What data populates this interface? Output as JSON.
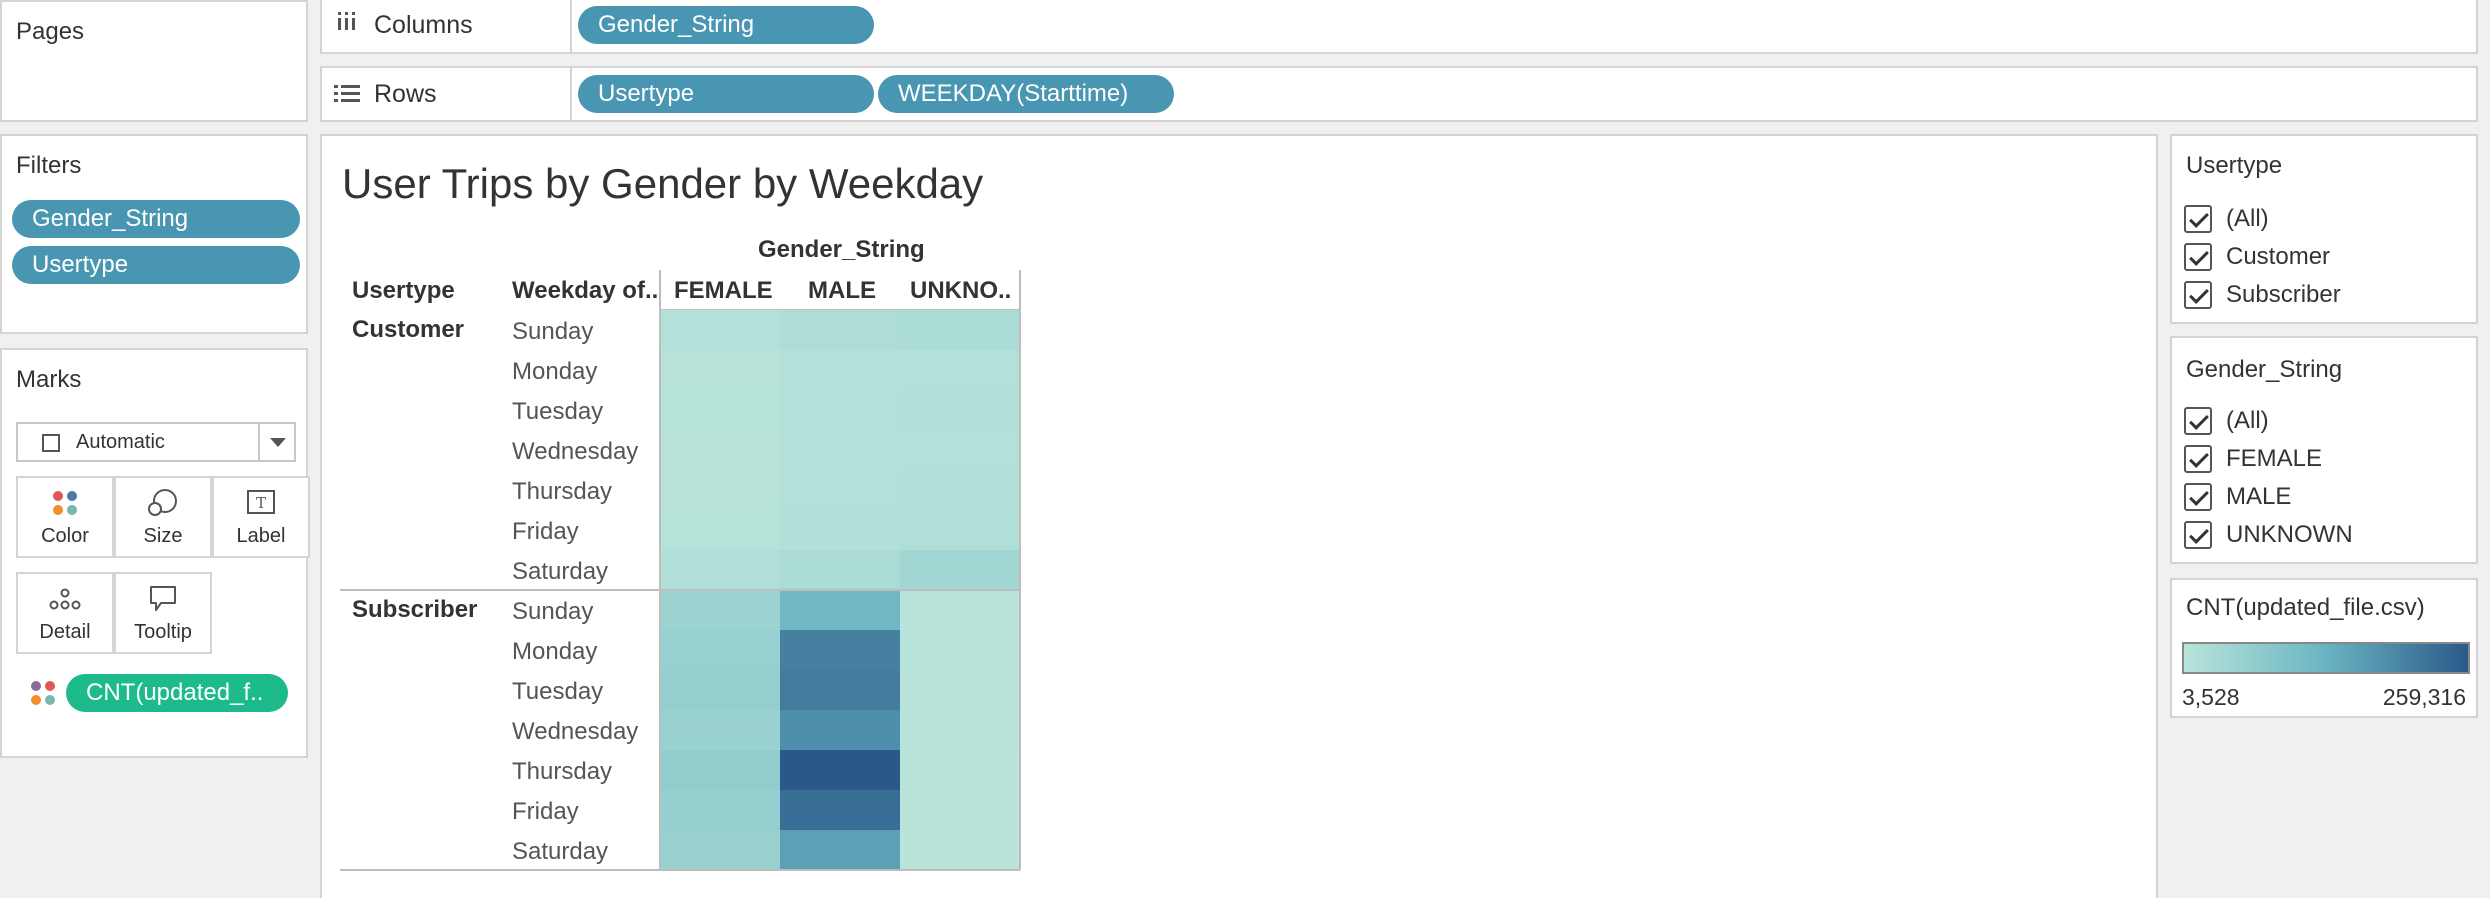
{
  "pages": {
    "title": "Pages"
  },
  "shelves": {
    "columns_label": "Columns",
    "rows_label": "Rows",
    "columns_pills": [
      "Gender_String"
    ],
    "rows_pills": [
      "Usertype",
      "WEEKDAY(Starttime)"
    ]
  },
  "filters": {
    "title": "Filters",
    "pills": [
      "Gender_String",
      "Usertype"
    ]
  },
  "marks": {
    "title": "Marks",
    "type": "Automatic",
    "buttons": [
      "Color",
      "Size",
      "Label",
      "Detail",
      "Tooltip"
    ],
    "field": "CNT(updated_f.."
  },
  "viz": {
    "title": "User Trips by Gender by Weekday",
    "col_field": "Gender_String",
    "row_header_1": "Usertype",
    "row_header_2": "Weekday of..",
    "columns": [
      "FEMALE",
      "MALE",
      "UNKNO.."
    ],
    "groups": [
      {
        "name": "Customer",
        "days": [
          "Sunday",
          "Monday",
          "Tuesday",
          "Wednesday",
          "Thursday",
          "Friday",
          "Saturday"
        ]
      },
      {
        "name": "Subscriber",
        "days": [
          "Sunday",
          "Monday",
          "Tuesday",
          "Wednesday",
          "Thursday",
          "Friday",
          "Saturday"
        ]
      }
    ]
  },
  "chart_data": {
    "type": "heatmap",
    "title": "User Trips by Gender by Weekday",
    "x_field": "Gender_String",
    "y_fields": [
      "Usertype",
      "Weekday of.."
    ],
    "x": [
      "FEMALE",
      "MALE",
      "UNKNO.."
    ],
    "y": [
      "Customer|Sunday",
      "Customer|Monday",
      "Customer|Tuesday",
      "Customer|Wednesday",
      "Customer|Thursday",
      "Customer|Friday",
      "Customer|Saturday",
      "Subscriber|Sunday",
      "Subscriber|Monday",
      "Subscriber|Tuesday",
      "Subscriber|Wednesday",
      "Subscriber|Thursday",
      "Subscriber|Friday",
      "Subscriber|Saturday"
    ],
    "values": [
      [
        14000,
        22000,
        26000
      ],
      [
        9000,
        13000,
        14000
      ],
      [
        9500,
        14000,
        15000
      ],
      [
        8000,
        13000,
        14000
      ],
      [
        8500,
        14000,
        15000
      ],
      [
        10000,
        15000,
        18000
      ],
      [
        18000,
        28000,
        40000
      ],
      [
        50000,
        120000,
        6000
      ],
      [
        58000,
        205000,
        5000
      ],
      [
        62000,
        210000,
        5000
      ],
      [
        55000,
        185000,
        5000
      ],
      [
        66000,
        259316,
        4500
      ],
      [
        60000,
        230000,
        4000
      ],
      [
        56000,
        160000,
        3528
      ]
    ],
    "color_min": 3528,
    "color_max": 259316,
    "color_low": "#b9e4da",
    "color_high": "#2a5989"
  },
  "legend": {
    "title": "CNT(updated_file.csv)",
    "min_label": "3,528",
    "max_label": "259,316"
  },
  "usertype_filter": {
    "title": "Usertype",
    "items": [
      "(All)",
      "Customer",
      "Subscriber"
    ]
  },
  "gender_filter": {
    "title": "Gender_String",
    "items": [
      "(All)",
      "FEMALE",
      "MALE",
      "UNKNOWN"
    ]
  }
}
